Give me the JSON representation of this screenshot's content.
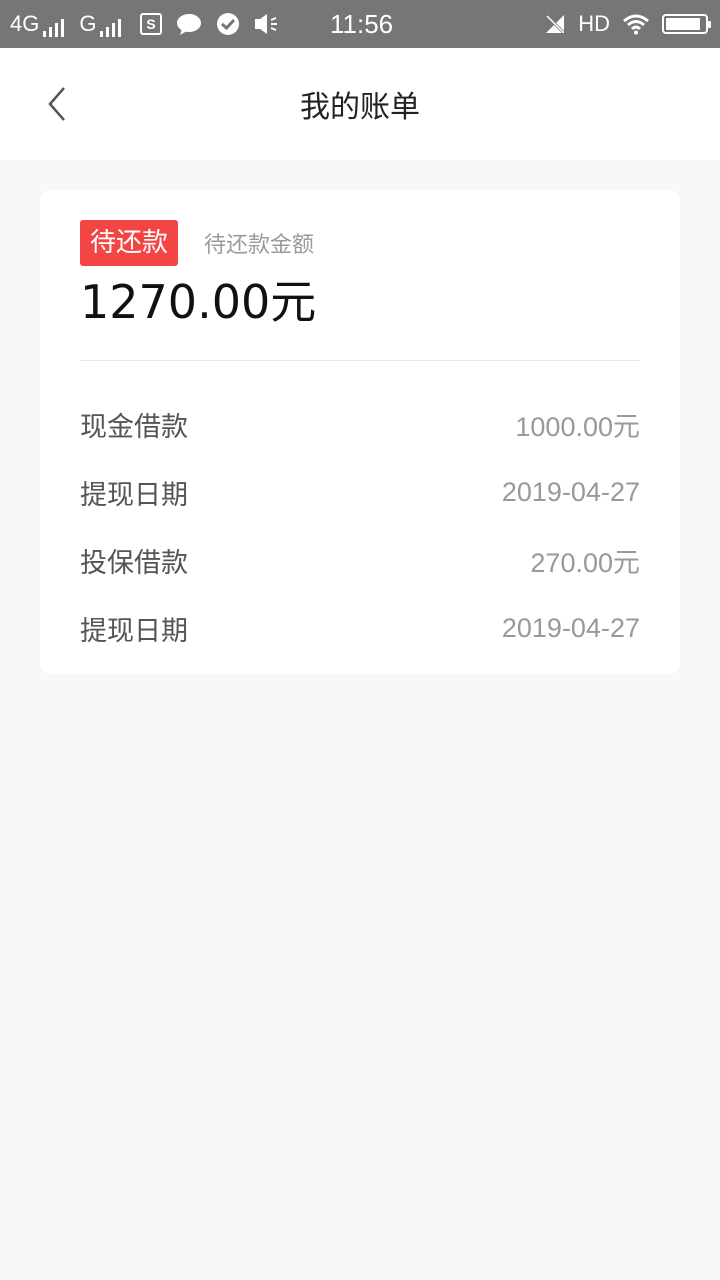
{
  "status_bar": {
    "network_1": "4G",
    "network_2": "G",
    "time": "11:56",
    "hd_label": "HD",
    "battery_level": 0.9,
    "icons": [
      "signal-bars-icon",
      "s-app-icon",
      "chat-bubble-icon",
      "check-circle-icon",
      "speaker-icon",
      "mute-icon",
      "wifi-icon",
      "battery-icon"
    ]
  },
  "header": {
    "title": "我的账单",
    "back_icon": "chevron-left-icon"
  },
  "bill": {
    "tag": "待还款",
    "caption": "待还款金额",
    "amount": "1270.00元",
    "rows": [
      {
        "label": "现金借款",
        "value": "1000.00元"
      },
      {
        "label": "提现日期",
        "value": "2019-04-27"
      },
      {
        "label": "投保借款",
        "value": "270.00元"
      },
      {
        "label": "提现日期",
        "value": "2019-04-27"
      }
    ]
  },
  "colors": {
    "accent": "#f44545",
    "status_bar": "#767676",
    "background": "#f8f8f8"
  }
}
